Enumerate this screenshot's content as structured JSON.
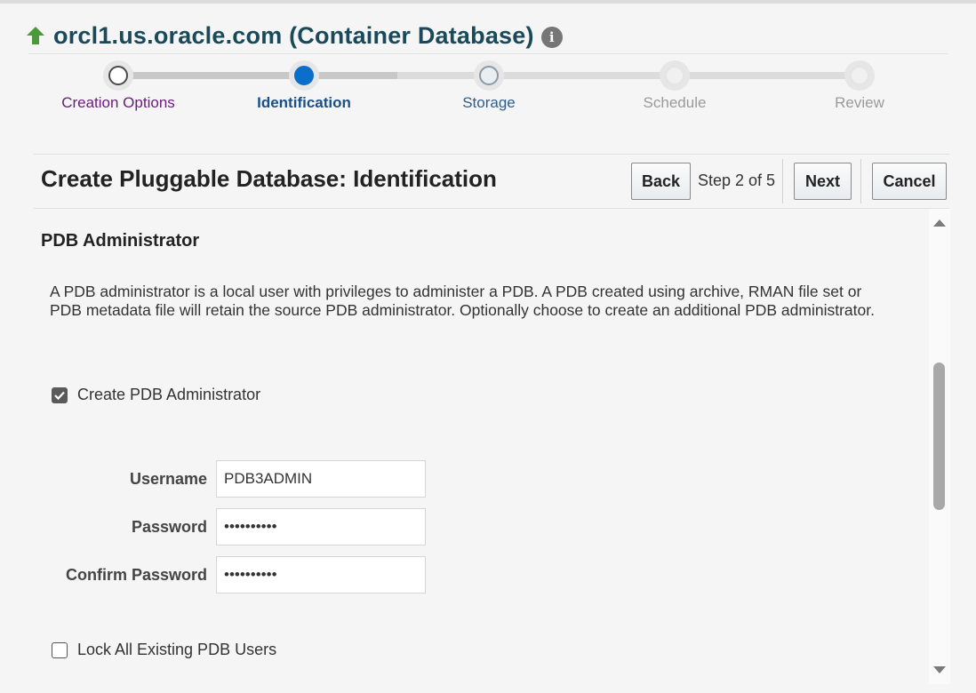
{
  "header": {
    "title": "orcl1.us.oracle.com (Container Database)",
    "info_glyph": "i",
    "arrow_color": "#4a9a3a"
  },
  "train": {
    "steps": [
      {
        "label": "Creation Options",
        "state": "visited"
      },
      {
        "label": "Identification",
        "state": "current"
      },
      {
        "label": "Storage",
        "state": "next"
      },
      {
        "label": "Schedule",
        "state": "disabled"
      },
      {
        "label": "Review",
        "state": "disabled"
      }
    ]
  },
  "toolbar": {
    "title": "Create Pluggable Database: Identification",
    "back_label": "Back",
    "step_text": "Step 2 of 5",
    "next_label": "Next",
    "cancel_label": "Cancel"
  },
  "section": {
    "title": "PDB Administrator",
    "description": "A PDB administrator is a local user with privileges to administer a PDB. A PDB created using archive, RMAN file set or PDB metadata file will retain the source PDB administrator. Optionally choose to create an additional PDB administrator.",
    "create_admin": {
      "label": "Create PDB Administrator",
      "checked": true
    },
    "username": {
      "label": "Username",
      "value": "PDB3ADMIN"
    },
    "password": {
      "label": "Password",
      "value": "••••••••••"
    },
    "confirm_password": {
      "label": "Confirm Password",
      "value": "••••••••••"
    },
    "lock_users": {
      "label": "Lock All Existing PDB Users",
      "checked": false
    }
  },
  "colors": {
    "accent": "#0a6fca",
    "title": "#1a4a5a",
    "visited": "#6a1b7a"
  }
}
